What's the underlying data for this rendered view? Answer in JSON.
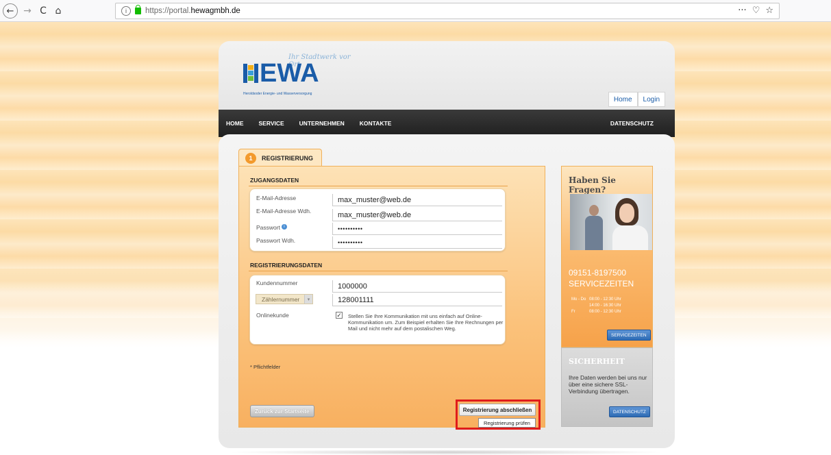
{
  "browser": {
    "url_prefix": "https://portal.",
    "url_domain": "hewagmbh.de",
    "back": "←",
    "forward": "→",
    "reload": "C",
    "home": "⌂",
    "info": "i",
    "actions": [
      "···",
      "♡",
      "☆"
    ]
  },
  "header": {
    "logo_tag": "Ihr Stadtwerk vor Ort",
    "logo_text": "EWA",
    "logo_sub": "Heroldsoder Energie- und Wasserversorgung",
    "top_links": [
      "Home",
      "Login"
    ],
    "nav": [
      "HOME",
      "SERVICE",
      "UNTERNEHMEN",
      "KONTAKTE"
    ],
    "nav_right": "DATENSCHUTZ"
  },
  "form": {
    "tab_number": "1",
    "tab_label": "REGISTRIERUNG",
    "zugang_title": "ZUGANGSDATEN",
    "email_label": "E-Mail-Adresse",
    "email_value": "max_muster@web.de",
    "email2_label": "E-Mail-Adresse Wdh.",
    "email2_value": "max_muster@web.de",
    "password_label": "Passwort",
    "password_value": "••••••••••",
    "password2_label": "Passwort Wdh.",
    "password2_value": "••••••••••",
    "reg_title": "REGISTRIERUNGSDATEN",
    "kunden_label": "Kundennummer",
    "kunden_value": "1000000",
    "zaehler_select": "Zählernummer",
    "zaehler_value": "128001111",
    "online_label": "Onlinekunde",
    "online_checked": "✓",
    "online_text": "Stellen Sie Ihre Kommunikation mit uns einfach auf Online-Kommunikation um. Zum Beispiel erhalten Sie Ihre Rechnungen per Mail und nicht mehr auf dem postalischen Weg.",
    "pflicht": "* Pflichtfelder",
    "back_button": "Zurück zur Startseite",
    "submit_button": "Registrierung abschließen",
    "tooltip": "Registrierung prüfen"
  },
  "sidebar": {
    "title": "Haben Sie Fragen?",
    "phone": "09151-8197500",
    "service_title": "SERVICEZEITEN",
    "hours": [
      {
        "day": "Mo - Do",
        "time": "08:00 - 12:30 Uhr"
      },
      {
        "day": "",
        "time": "14:00 - 16:30 Uhr"
      },
      {
        "day": "Fr",
        "time": "08:00 - 12:30 Uhr"
      }
    ],
    "service_button": "SERVICEZEITEN",
    "security_title": "SICHERHEIT",
    "security_text": "Ihre Daten werden bei uns nur über eine sichere SSL-Verbindung übertragen.",
    "privacy_button": "DATENSCHUTZ"
  },
  "colors": {
    "accent_orange": "#f39a2c",
    "brand_blue": "#1a5ca8",
    "highlight_red": "#e01b1b"
  }
}
